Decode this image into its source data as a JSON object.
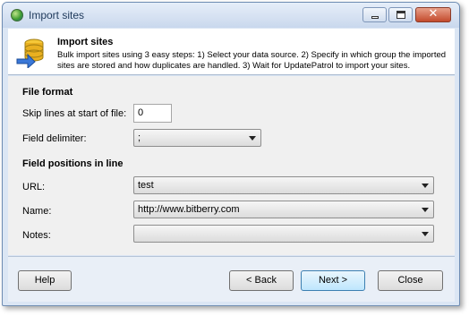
{
  "window": {
    "title": "Import sites",
    "controls": [
      "minimize-icon",
      "maximize-icon",
      "close-icon"
    ]
  },
  "header": {
    "icon": "database-arrow-icon",
    "title": "Import sites",
    "description": "Bulk import sites using 3 easy steps: 1) Select your data source. 2) Specify in which group the imported sites are stored and how duplicates are handled. 3) Wait for UpdatePatrol to import your sites."
  },
  "file_format": {
    "heading": "File format",
    "skip_lines_label": "Skip lines at start of file:",
    "skip_lines_value": "0",
    "delimiter_label": "Field delimiter:",
    "delimiter_value": ";"
  },
  "field_positions": {
    "heading": "Field positions in line",
    "url_label": "URL:",
    "url_value": "test",
    "name_label": "Name:",
    "name_value": "http://www.bitberry.com",
    "notes_label": "Notes:",
    "notes_value": ""
  },
  "footer": {
    "help": "Help",
    "back": "< Back",
    "next": "Next >",
    "close": "Close"
  }
}
